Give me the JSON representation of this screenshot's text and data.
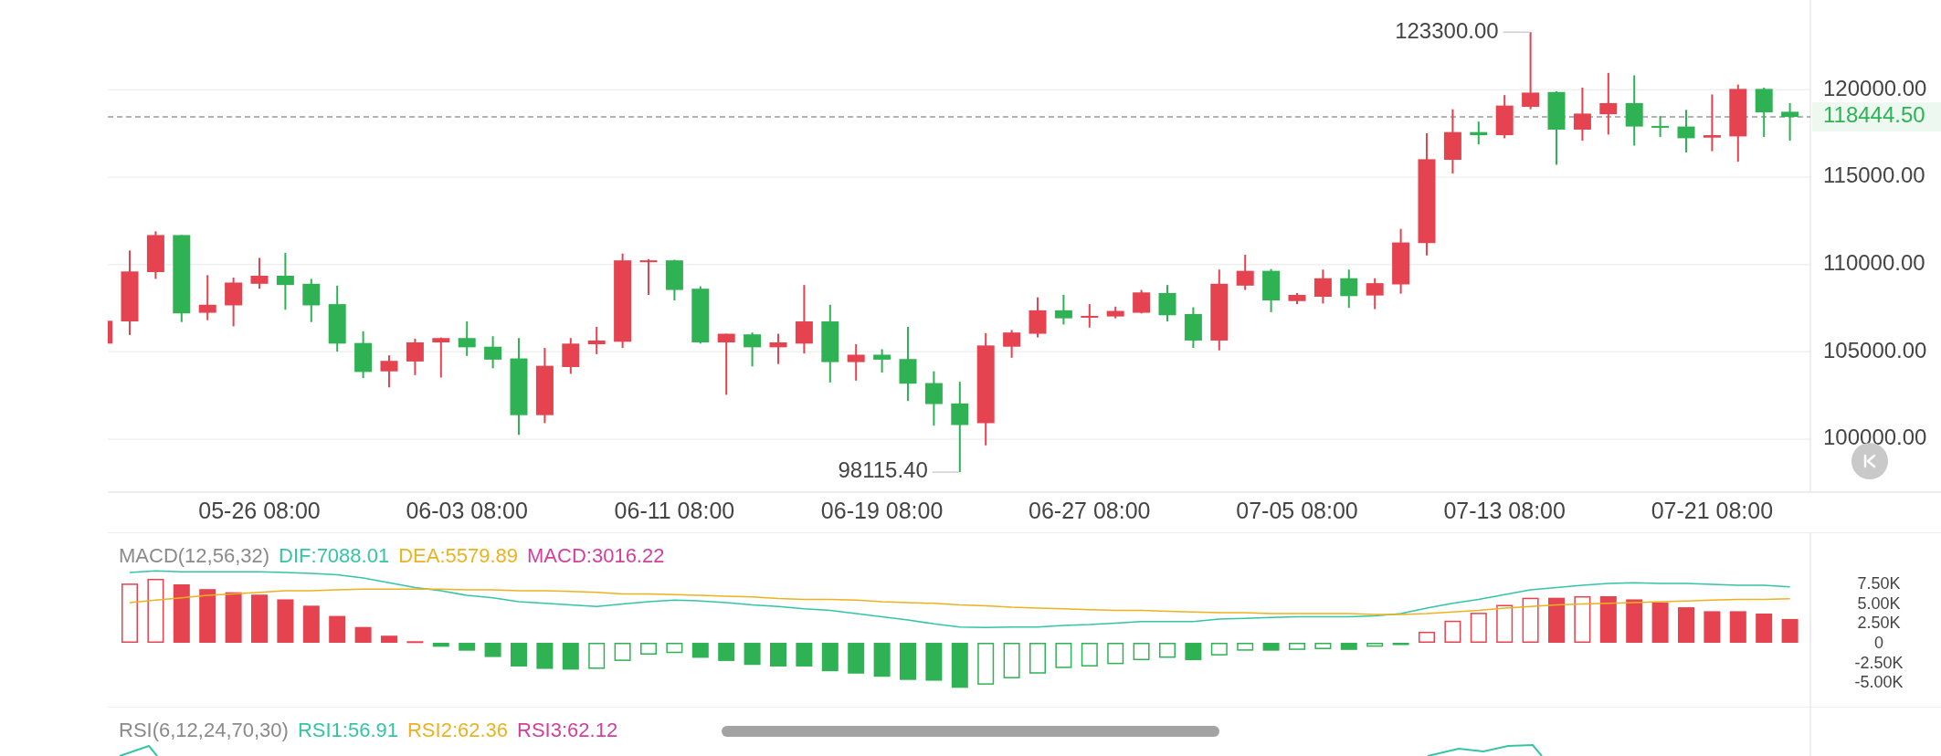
{
  "price_chart": {
    "axis_labels": [
      "120000.00",
      "115000.00",
      "110000.00",
      "105000.00",
      "100000.00"
    ],
    "date_labels": [
      "05-26 08:00",
      "06-03 08:00",
      "06-11 08:00",
      "06-19 08:00",
      "06-27 08:00",
      "07-05 08:00",
      "07-13 08:00",
      "07-21 08:00"
    ],
    "high_label": "123300.00",
    "low_label": "98115.40",
    "last_price": "118444.50"
  },
  "macd": {
    "legend": [
      {
        "text": "MACD(12,56,32)",
        "color": "#8a8a8a"
      },
      {
        "text": "DIF:7088.01",
        "color": "#33c5a5"
      },
      {
        "text": "DEA:5579.89",
        "color": "#ecb21f"
      },
      {
        "text": "MACD:3016.22",
        "color": "#d33f9c"
      }
    ],
    "chart_data": {
      "type": "bar",
      "series": [
        {
          "type": "bar",
          "values": [
            7500,
            8100,
            7400,
            6800,
            6400,
            6100,
            5500,
            4700,
            3400,
            2000,
            900,
            200,
            -500,
            -1000,
            -1800,
            -3000,
            -3300,
            -3400,
            -3300,
            -2300,
            -1500,
            -1300,
            -1900,
            -2300,
            -2800,
            -3000,
            -3000,
            -3600,
            -3900,
            -4300,
            -4700,
            -4800,
            -5700,
            -5300,
            -4500,
            -3900,
            -3200,
            -3000,
            -2700,
            -2200,
            -1900,
            -2200,
            -1600,
            -1000,
            -1000,
            -900,
            -800,
            -900,
            -500,
            -100,
            1400,
            2800,
            3800,
            4800,
            5700,
            5700,
            5900,
            5900,
            5500,
            5100,
            4500,
            4000,
            4000,
            3700,
            3016.22
          ],
          "colors": [
            "#e4434f",
            "#e4434f",
            "#e4434f",
            "#e4434f",
            "#e4434f",
            "#e4434f",
            "#e4434f",
            "#e4434f",
            "#e4434f",
            "#e4434f",
            "#e4434f",
            "#e4434f",
            "#2fb254",
            "#2fb254",
            "#2fb254",
            "#2fb254",
            "#2fb254",
            "#2fb254",
            "#2fb254",
            "#2fb254",
            "#2fb254",
            "#2fb254",
            "#2fb254",
            "#2fb254",
            "#2fb254",
            "#2fb254",
            "#2fb254",
            "#2fb254",
            "#2fb254",
            "#2fb254",
            "#2fb254",
            "#2fb254",
            "#2fb254",
            "#2fb254",
            "#2fb254",
            "#2fb254",
            "#2fb254",
            "#2fb254",
            "#2fb254",
            "#2fb254",
            "#2fb254",
            "#2fb254",
            "#2fb254",
            "#2fb254",
            "#2fb254",
            "#2fb254",
            "#2fb254",
            "#2fb254",
            "#2fb254",
            "#2fb254",
            "#e4434f",
            "#e4434f",
            "#e4434f",
            "#e4434f",
            "#e4434f",
            "#e4434f",
            "#e4434f",
            "#e4434f",
            "#e4434f",
            "#e4434f",
            "#e4434f",
            "#e4434f",
            "#e4434f",
            "#e4434f",
            "#e4434f"
          ]
        },
        {
          "type": "line",
          "color": "#33c5a5",
          "values": [
            8900,
            9100,
            9000,
            9000,
            9000,
            9000,
            8900,
            8800,
            8600,
            8200,
            7600,
            7000,
            6600,
            6000,
            5700,
            5200,
            5000,
            4800,
            4600,
            4900,
            5200,
            5400,
            5300,
            5100,
            4800,
            4600,
            4300,
            4100,
            3700,
            3300,
            2900,
            2400,
            2000,
            1950,
            2000,
            2000,
            2200,
            2300,
            2500,
            2700,
            2700,
            2700,
            3000,
            3100,
            3200,
            3300,
            3300,
            3300,
            3400,
            3700,
            4400,
            5000,
            5500,
            6100,
            6700,
            7000,
            7300,
            7500,
            7600,
            7500,
            7500,
            7400,
            7300,
            7300,
            7088.01
          ]
        },
        {
          "type": "line",
          "color": "#ecb21f",
          "values": [
            5100,
            5400,
            5700,
            6000,
            6200,
            6400,
            6600,
            6600,
            6700,
            6800,
            6800,
            6800,
            6800,
            6700,
            6700,
            6600,
            6600,
            6500,
            6400,
            6200,
            6200,
            6100,
            6000,
            5900,
            5800,
            5600,
            5500,
            5500,
            5400,
            5200,
            5100,
            5000,
            4800,
            4700,
            4500,
            4400,
            4300,
            4200,
            4100,
            4100,
            4000,
            3900,
            3800,
            3800,
            3700,
            3700,
            3700,
            3700,
            3600,
            3600,
            3700,
            3900,
            4100,
            4400,
            4600,
            4800,
            4900,
            5000,
            5100,
            5200,
            5300,
            5400,
            5500,
            5500,
            5579.89
          ]
        }
      ],
      "ylim": [
        -8090,
        13990
      ],
      "yticks": [
        {
          "value": 7500,
          "label": "7.50K"
        },
        {
          "value": 5000,
          "label": "5.00K"
        },
        {
          "value": 2500,
          "label": "2.50K"
        },
        {
          "value": 0,
          "label": "0"
        },
        {
          "value": -2500,
          "label": "-2.50K"
        },
        {
          "value": -5000,
          "label": "-5.00K"
        }
      ]
    }
  },
  "rsi": {
    "legend": [
      {
        "text": "RSI(6,12,24,70,30)",
        "color": "#8a8a8a"
      },
      {
        "text": "RSI1:56.91",
        "color": "#33c5a5"
      },
      {
        "text": "RSI2:62.36",
        "color": "#ecb21f"
      },
      {
        "text": "RSI3:62.12",
        "color": "#d33f9c"
      }
    ]
  }
}
